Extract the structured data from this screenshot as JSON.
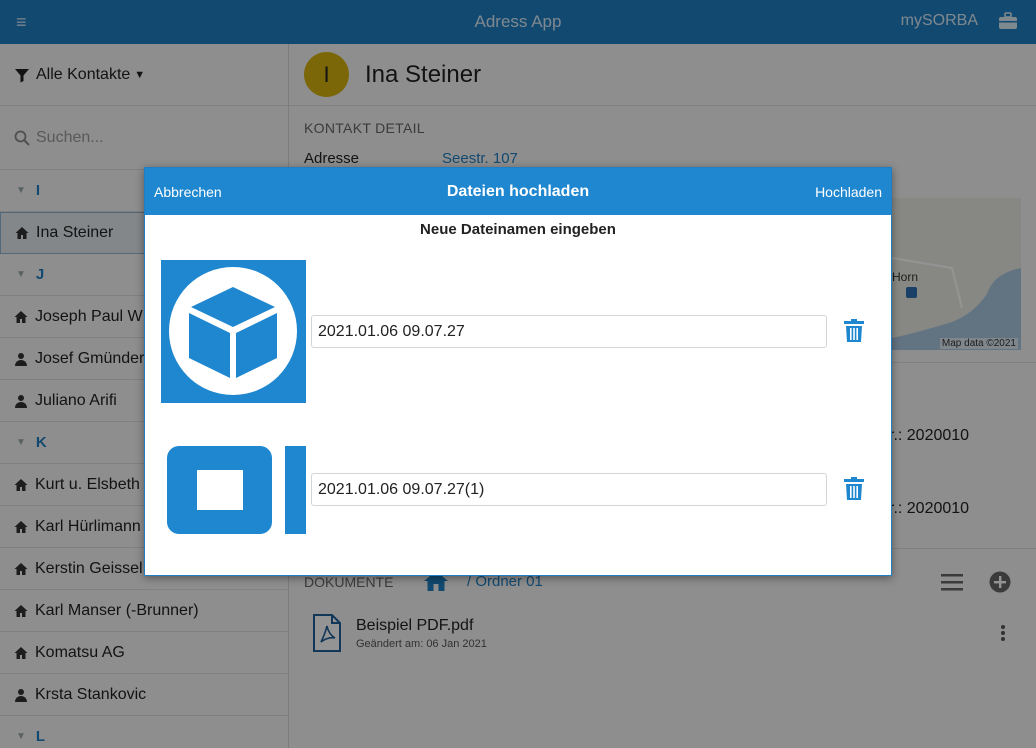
{
  "app": {
    "title": "Adress App",
    "user_label": "mySORBA"
  },
  "sidebar": {
    "filter_label": "Alle Kontakte",
    "search_placeholder": "Suchen...",
    "sections": {
      "i": "I",
      "j": "J",
      "k": "K",
      "l": "L"
    },
    "rows": [
      {
        "label": "Ina Steiner",
        "icon": "home-icon"
      },
      {
        "label": "Joseph Paul W",
        "icon": "home-icon"
      },
      {
        "label": "Josef Gmünder",
        "icon": "person-icon"
      },
      {
        "label": "Juliano Arifi",
        "icon": "person-icon"
      },
      {
        "label": "Kurt u. Elsbeth",
        "icon": "home-icon"
      },
      {
        "label": "Karl Hürlimann",
        "icon": "home-icon"
      },
      {
        "label": "Kerstin Geissel",
        "icon": "home-icon"
      },
      {
        "label": "Karl Manser (-Brunner)",
        "icon": "home-icon"
      },
      {
        "label": "Komatsu AG",
        "icon": "home-icon"
      },
      {
        "label": "Krsta Stankovic",
        "icon": "person-icon"
      }
    ]
  },
  "contact": {
    "initial": "I",
    "name": "Ina Steiner",
    "section_title": "KONTAKT DETAIL",
    "address_label": "Adresse",
    "address_value": "Seestr. 107",
    "map_place": "Horn",
    "map_attribution": "Map data ©2021",
    "nr1": "r.: 2020010",
    "nr2": "r.: 2020010"
  },
  "documents": {
    "label": "DOKUMENTE",
    "path": "/ Ordner 01",
    "file_name": "Beispiel PDF.pdf",
    "file_meta": "Geändert am: 06 Jan 2021"
  },
  "modal": {
    "cancel_label": "Abbrechen",
    "title": "Dateien hochladen",
    "upload_label": "Hochladen",
    "subtitle": "Neue Dateinamen eingeben",
    "files": [
      {
        "name": "2021.01.06 09.07.27"
      },
      {
        "name": "2021.01.06 09.07.27(1)"
      }
    ]
  },
  "colors": {
    "accent": "#1f87cf",
    "topbar": "#1f7fc2",
    "avatar": "#d4b20f"
  }
}
